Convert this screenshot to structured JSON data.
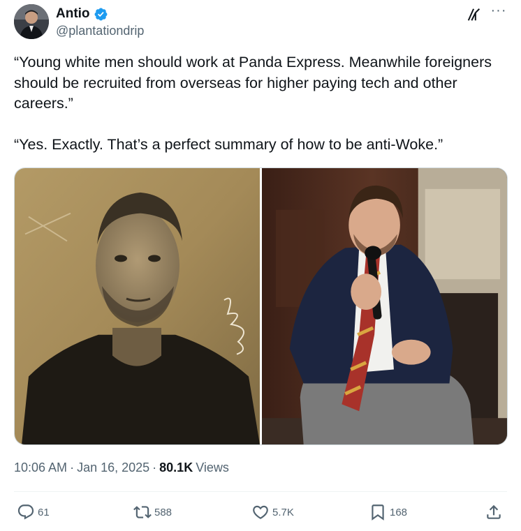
{
  "author": {
    "name": "Antio",
    "handle": "@plantationdrip",
    "verified": true
  },
  "tweet": {
    "paragraphs": [
      "“Young white men should work at Panda Express. Meanwhile foreigners should be recruited from overseas for higher paying tech and other careers.”",
      "“Yes. Exactly. That’s a perfect summary of how to be anti-Woke.”"
    ]
  },
  "meta": {
    "time": "10:06 AM",
    "date": "Jan 16, 2025",
    "separator": "·",
    "views_count": "80.1K",
    "views_label": "Views"
  },
  "actions": {
    "replies": "61",
    "reposts": "588",
    "likes": "5.7K",
    "bookmarks": "168"
  },
  "icons": {
    "verified": "verified-badge-icon",
    "grok": "grok-icon",
    "more": "more-icon",
    "reply": "reply-icon",
    "repost": "repost-icon",
    "like": "heart-icon",
    "bookmark": "bookmark-icon",
    "share": "share-icon"
  },
  "colors": {
    "text_primary": "#0f1419",
    "text_secondary": "#536471",
    "verified_blue": "#1d9bf0",
    "border": "#cfd9de"
  }
}
